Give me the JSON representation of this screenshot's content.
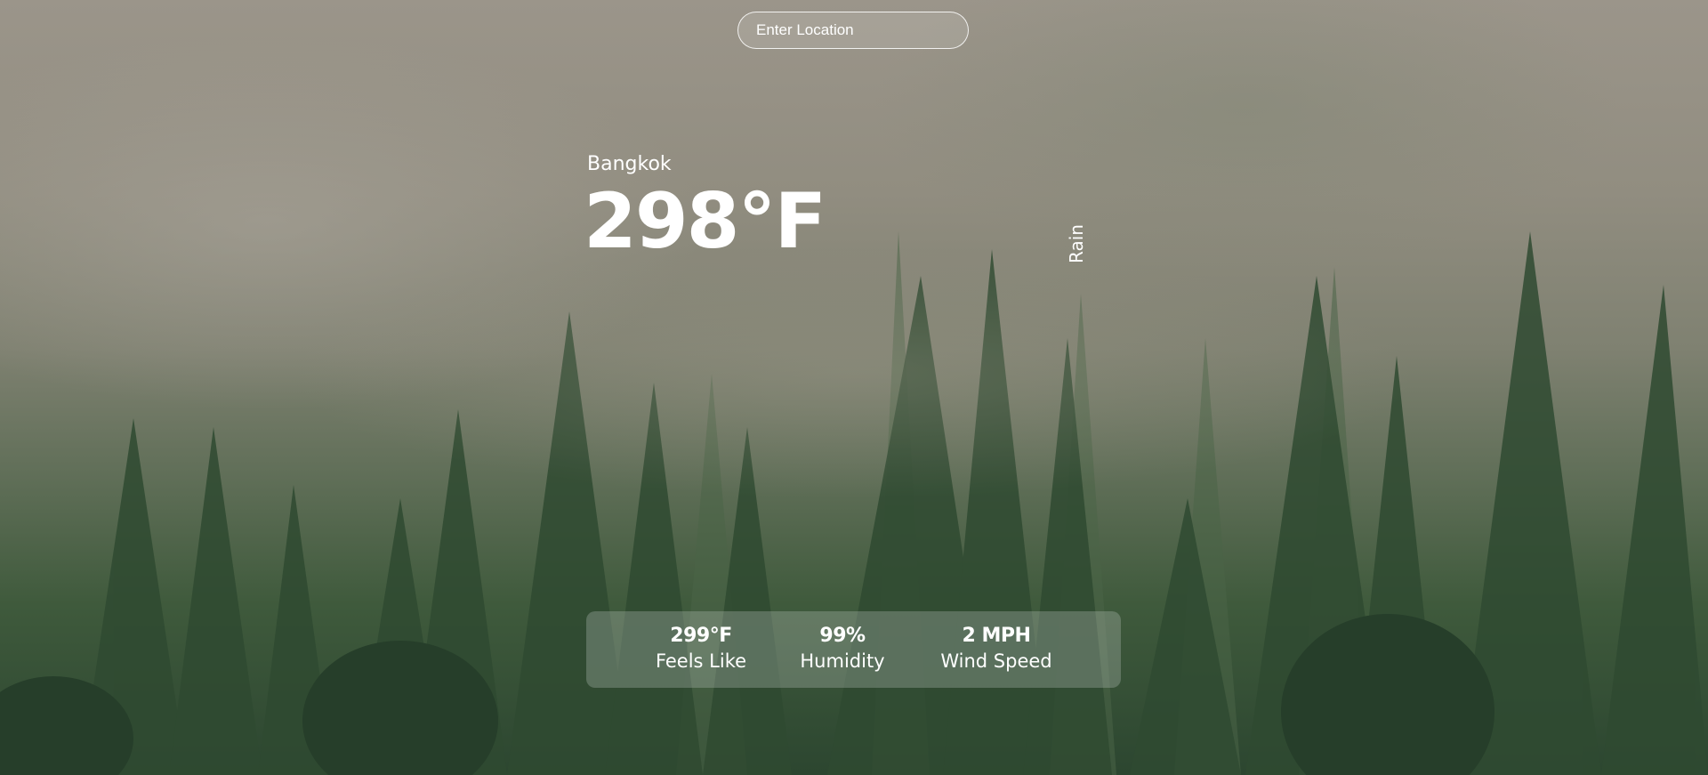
{
  "search": {
    "placeholder": "Enter Location",
    "value": ""
  },
  "current": {
    "location": "Bangkok",
    "temperature": "298°F",
    "condition": "Rain"
  },
  "stats": [
    {
      "value": "299°F",
      "label": "Feels Like"
    },
    {
      "value": "99%",
      "label": "Humidity"
    },
    {
      "value": "2 MPH",
      "label": "Wind Speed"
    }
  ],
  "colors": {
    "text": "#ffffff",
    "panel": "#c8d2cd",
    "forest_dark": "#2c4630",
    "fog": "#9b958a"
  }
}
